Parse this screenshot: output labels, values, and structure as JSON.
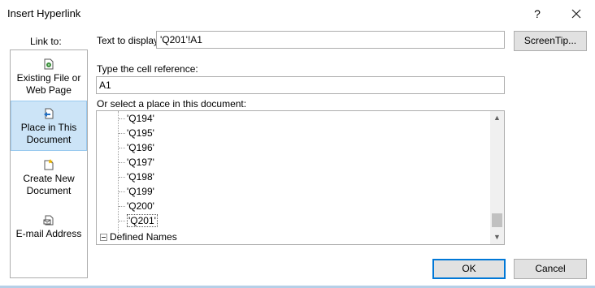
{
  "window": {
    "title": "Insert Hyperlink",
    "help_label": "?"
  },
  "sidebar": {
    "label": "Link to:",
    "items": [
      {
        "line1": "Existing File or",
        "line2": "Web Page",
        "icon": "existing-file-icon"
      },
      {
        "line1": "Place in This",
        "line2": "Document",
        "icon": "place-in-document-icon",
        "selected": true
      },
      {
        "line1": "Create New",
        "line2": "Document",
        "icon": "new-document-icon"
      },
      {
        "line1": "E-mail Address",
        "line2": "",
        "icon": "email-icon"
      }
    ]
  },
  "text_to_display": {
    "label": "Text to display:",
    "value": "'Q201'!A1"
  },
  "screentip_label": "ScreenTip...",
  "cell_reference": {
    "label": "Type the cell reference:",
    "value": "A1"
  },
  "place": {
    "label": "Or select a place in this document:",
    "items": [
      "'Q194'",
      "'Q195'",
      "'Q196'",
      "'Q197'",
      "'Q198'",
      "'Q199'",
      "'Q200'",
      "'Q201'"
    ],
    "selected_item": "'Q201'",
    "defined_names": "Defined Names"
  },
  "buttons": {
    "ok": "OK",
    "cancel": "Cancel"
  },
  "colors": {
    "selection": "#cce4f7",
    "default_button_border": "#0078d7"
  }
}
